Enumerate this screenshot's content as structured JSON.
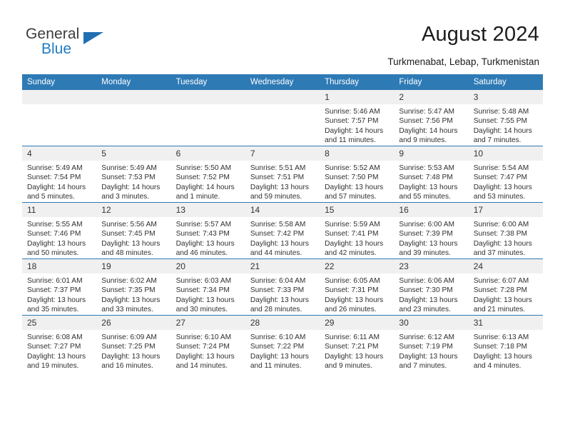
{
  "logo": {
    "word_top": "General",
    "word_bottom": "Blue",
    "triangle_color": "#1f6fb2",
    "blue_color": "#1f7bc1"
  },
  "header": {
    "title": "August 2024",
    "subtitle": "Turkmenabat, Lebap, Turkmenistan"
  },
  "theme": {
    "header_blue": "#2e7ab5",
    "daynum_band": "#f0f0f0",
    "text": "#303030"
  },
  "calendar": {
    "weekday_headers": [
      "Sunday",
      "Monday",
      "Tuesday",
      "Wednesday",
      "Thursday",
      "Friday",
      "Saturday"
    ],
    "weeks": [
      [
        {
          "day": "",
          "blank": true,
          "sunrise": "",
          "sunset": "",
          "daylight_line1": "",
          "daylight_line2": ""
        },
        {
          "day": "",
          "blank": true,
          "sunrise": "",
          "sunset": "",
          "daylight_line1": "",
          "daylight_line2": ""
        },
        {
          "day": "",
          "blank": true,
          "sunrise": "",
          "sunset": "",
          "daylight_line1": "",
          "daylight_line2": ""
        },
        {
          "day": "",
          "blank": true,
          "sunrise": "",
          "sunset": "",
          "daylight_line1": "",
          "daylight_line2": ""
        },
        {
          "day": "1",
          "blank": false,
          "sunrise": "Sunrise: 5:46 AM",
          "sunset": "Sunset: 7:57 PM",
          "daylight_line1": "Daylight: 14 hours",
          "daylight_line2": "and 11 minutes."
        },
        {
          "day": "2",
          "blank": false,
          "sunrise": "Sunrise: 5:47 AM",
          "sunset": "Sunset: 7:56 PM",
          "daylight_line1": "Daylight: 14 hours",
          "daylight_line2": "and 9 minutes."
        },
        {
          "day": "3",
          "blank": false,
          "sunrise": "Sunrise: 5:48 AM",
          "sunset": "Sunset: 7:55 PM",
          "daylight_line1": "Daylight: 14 hours",
          "daylight_line2": "and 7 minutes."
        }
      ],
      [
        {
          "day": "4",
          "blank": false,
          "sunrise": "Sunrise: 5:49 AM",
          "sunset": "Sunset: 7:54 PM",
          "daylight_line1": "Daylight: 14 hours",
          "daylight_line2": "and 5 minutes."
        },
        {
          "day": "5",
          "blank": false,
          "sunrise": "Sunrise: 5:49 AM",
          "sunset": "Sunset: 7:53 PM",
          "daylight_line1": "Daylight: 14 hours",
          "daylight_line2": "and 3 minutes."
        },
        {
          "day": "6",
          "blank": false,
          "sunrise": "Sunrise: 5:50 AM",
          "sunset": "Sunset: 7:52 PM",
          "daylight_line1": "Daylight: 14 hours",
          "daylight_line2": "and 1 minute."
        },
        {
          "day": "7",
          "blank": false,
          "sunrise": "Sunrise: 5:51 AM",
          "sunset": "Sunset: 7:51 PM",
          "daylight_line1": "Daylight: 13 hours",
          "daylight_line2": "and 59 minutes."
        },
        {
          "day": "8",
          "blank": false,
          "sunrise": "Sunrise: 5:52 AM",
          "sunset": "Sunset: 7:50 PM",
          "daylight_line1": "Daylight: 13 hours",
          "daylight_line2": "and 57 minutes."
        },
        {
          "day": "9",
          "blank": false,
          "sunrise": "Sunrise: 5:53 AM",
          "sunset": "Sunset: 7:48 PM",
          "daylight_line1": "Daylight: 13 hours",
          "daylight_line2": "and 55 minutes."
        },
        {
          "day": "10",
          "blank": false,
          "sunrise": "Sunrise: 5:54 AM",
          "sunset": "Sunset: 7:47 PM",
          "daylight_line1": "Daylight: 13 hours",
          "daylight_line2": "and 53 minutes."
        }
      ],
      [
        {
          "day": "11",
          "blank": false,
          "sunrise": "Sunrise: 5:55 AM",
          "sunset": "Sunset: 7:46 PM",
          "daylight_line1": "Daylight: 13 hours",
          "daylight_line2": "and 50 minutes."
        },
        {
          "day": "12",
          "blank": false,
          "sunrise": "Sunrise: 5:56 AM",
          "sunset": "Sunset: 7:45 PM",
          "daylight_line1": "Daylight: 13 hours",
          "daylight_line2": "and 48 minutes."
        },
        {
          "day": "13",
          "blank": false,
          "sunrise": "Sunrise: 5:57 AM",
          "sunset": "Sunset: 7:43 PM",
          "daylight_line1": "Daylight: 13 hours",
          "daylight_line2": "and 46 minutes."
        },
        {
          "day": "14",
          "blank": false,
          "sunrise": "Sunrise: 5:58 AM",
          "sunset": "Sunset: 7:42 PM",
          "daylight_line1": "Daylight: 13 hours",
          "daylight_line2": "and 44 minutes."
        },
        {
          "day": "15",
          "blank": false,
          "sunrise": "Sunrise: 5:59 AM",
          "sunset": "Sunset: 7:41 PM",
          "daylight_line1": "Daylight: 13 hours",
          "daylight_line2": "and 42 minutes."
        },
        {
          "day": "16",
          "blank": false,
          "sunrise": "Sunrise: 6:00 AM",
          "sunset": "Sunset: 7:39 PM",
          "daylight_line1": "Daylight: 13 hours",
          "daylight_line2": "and 39 minutes."
        },
        {
          "day": "17",
          "blank": false,
          "sunrise": "Sunrise: 6:00 AM",
          "sunset": "Sunset: 7:38 PM",
          "daylight_line1": "Daylight: 13 hours",
          "daylight_line2": "and 37 minutes."
        }
      ],
      [
        {
          "day": "18",
          "blank": false,
          "sunrise": "Sunrise: 6:01 AM",
          "sunset": "Sunset: 7:37 PM",
          "daylight_line1": "Daylight: 13 hours",
          "daylight_line2": "and 35 minutes."
        },
        {
          "day": "19",
          "blank": false,
          "sunrise": "Sunrise: 6:02 AM",
          "sunset": "Sunset: 7:35 PM",
          "daylight_line1": "Daylight: 13 hours",
          "daylight_line2": "and 33 minutes."
        },
        {
          "day": "20",
          "blank": false,
          "sunrise": "Sunrise: 6:03 AM",
          "sunset": "Sunset: 7:34 PM",
          "daylight_line1": "Daylight: 13 hours",
          "daylight_line2": "and 30 minutes."
        },
        {
          "day": "21",
          "blank": false,
          "sunrise": "Sunrise: 6:04 AM",
          "sunset": "Sunset: 7:33 PM",
          "daylight_line1": "Daylight: 13 hours",
          "daylight_line2": "and 28 minutes."
        },
        {
          "day": "22",
          "blank": false,
          "sunrise": "Sunrise: 6:05 AM",
          "sunset": "Sunset: 7:31 PM",
          "daylight_line1": "Daylight: 13 hours",
          "daylight_line2": "and 26 minutes."
        },
        {
          "day": "23",
          "blank": false,
          "sunrise": "Sunrise: 6:06 AM",
          "sunset": "Sunset: 7:30 PM",
          "daylight_line1": "Daylight: 13 hours",
          "daylight_line2": "and 23 minutes."
        },
        {
          "day": "24",
          "blank": false,
          "sunrise": "Sunrise: 6:07 AM",
          "sunset": "Sunset: 7:28 PM",
          "daylight_line1": "Daylight: 13 hours",
          "daylight_line2": "and 21 minutes."
        }
      ],
      [
        {
          "day": "25",
          "blank": false,
          "sunrise": "Sunrise: 6:08 AM",
          "sunset": "Sunset: 7:27 PM",
          "daylight_line1": "Daylight: 13 hours",
          "daylight_line2": "and 19 minutes."
        },
        {
          "day": "26",
          "blank": false,
          "sunrise": "Sunrise: 6:09 AM",
          "sunset": "Sunset: 7:25 PM",
          "daylight_line1": "Daylight: 13 hours",
          "daylight_line2": "and 16 minutes."
        },
        {
          "day": "27",
          "blank": false,
          "sunrise": "Sunrise: 6:10 AM",
          "sunset": "Sunset: 7:24 PM",
          "daylight_line1": "Daylight: 13 hours",
          "daylight_line2": "and 14 minutes."
        },
        {
          "day": "28",
          "blank": false,
          "sunrise": "Sunrise: 6:10 AM",
          "sunset": "Sunset: 7:22 PM",
          "daylight_line1": "Daylight: 13 hours",
          "daylight_line2": "and 11 minutes."
        },
        {
          "day": "29",
          "blank": false,
          "sunrise": "Sunrise: 6:11 AM",
          "sunset": "Sunset: 7:21 PM",
          "daylight_line1": "Daylight: 13 hours",
          "daylight_line2": "and 9 minutes."
        },
        {
          "day": "30",
          "blank": false,
          "sunrise": "Sunrise: 6:12 AM",
          "sunset": "Sunset: 7:19 PM",
          "daylight_line1": "Daylight: 13 hours",
          "daylight_line2": "and 7 minutes."
        },
        {
          "day": "31",
          "blank": false,
          "sunrise": "Sunrise: 6:13 AM",
          "sunset": "Sunset: 7:18 PM",
          "daylight_line1": "Daylight: 13 hours",
          "daylight_line2": "and 4 minutes."
        }
      ]
    ]
  }
}
